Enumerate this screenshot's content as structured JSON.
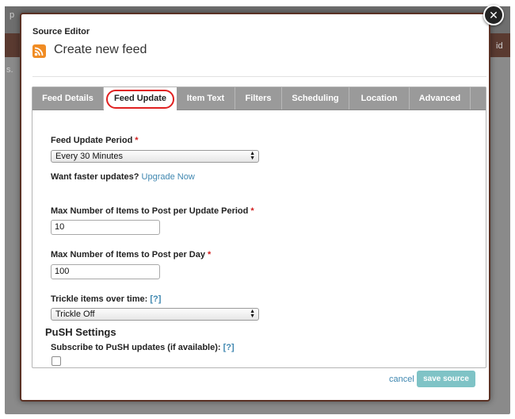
{
  "background": {
    "stub_1": "p",
    "stub_2": "s.",
    "stub_3": "id"
  },
  "modal": {
    "title": "Source Editor",
    "feed_title": "Create new feed"
  },
  "tabs": [
    {
      "label": "Feed Details",
      "active": false
    },
    {
      "label": "Feed Update",
      "active": true
    },
    {
      "label": "Item Text",
      "active": false
    },
    {
      "label": "Filters",
      "active": false
    },
    {
      "label": "Scheduling",
      "active": false
    },
    {
      "label": "Location",
      "active": false
    },
    {
      "label": "Advanced",
      "active": false
    }
  ],
  "form": {
    "update_period": {
      "label": "Feed Update Period",
      "required_mark": "*",
      "value": "Every 30 Minutes"
    },
    "faster_updates": {
      "text": "Want faster updates?",
      "link": "Upgrade Now"
    },
    "max_per_period": {
      "label": "Max Number of Items to Post per Update Period",
      "required_mark": "*",
      "value": "10"
    },
    "max_per_day": {
      "label": "Max Number of Items to Post per Day",
      "required_mark": "*",
      "value": "100"
    },
    "trickle": {
      "label": "Trickle items over time:",
      "help": "[?]",
      "value": "Trickle Off"
    },
    "push": {
      "heading": "PuSH Settings",
      "subscribe_label": "Subscribe to PuSH updates (if available):",
      "help": "[?]",
      "checked": false
    }
  },
  "footer": {
    "cancel_label": "cancel",
    "save_label": "save source"
  },
  "icons": {
    "close": "close-icon",
    "rss": "rss-icon",
    "select_arrow": "select-arrows-icon"
  },
  "colors": {
    "accent_link": "#3f87b0",
    "save_button": "#7fc3c6",
    "tab_bar": "#9a9a9a",
    "highlight_oval": "#e02020",
    "modal_border": "#5a3124"
  }
}
